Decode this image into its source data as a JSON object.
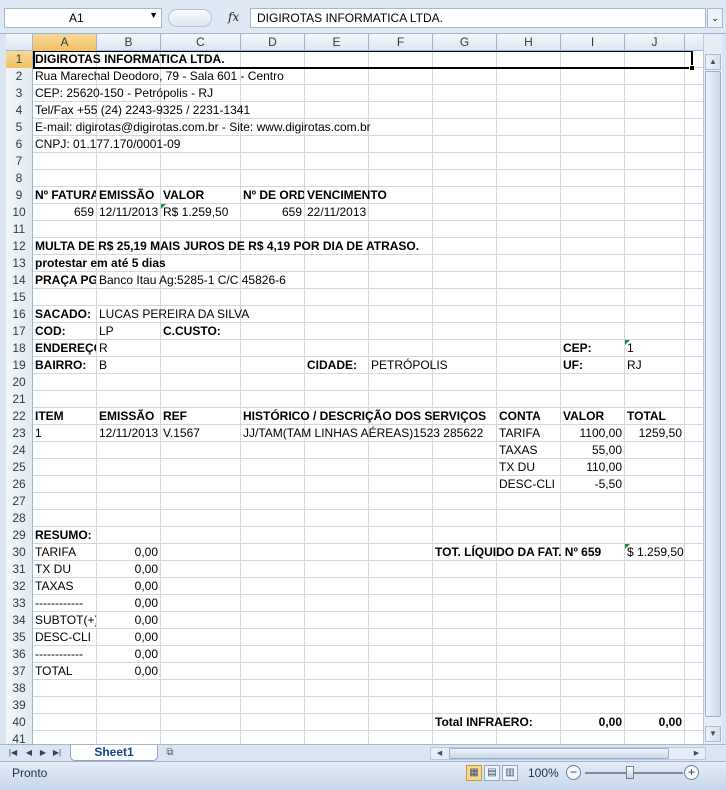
{
  "formula_bar": {
    "name_box": "A1",
    "fx_label": "fx",
    "content": "DIGIROTAS INFORMATICA LTDA."
  },
  "columns": [
    "A",
    "B",
    "C",
    "D",
    "E",
    "F",
    "G",
    "H",
    "I",
    "J"
  ],
  "rows": {
    "1": {
      "A": "DIGIROTAS INFORMATICA LTDA."
    },
    "2": {
      "A": "Rua Marechal Deodoro, 79 - Sala 601 - Centro"
    },
    "3": {
      "A": "CEP: 25620-150 - Petrópolis - RJ"
    },
    "4": {
      "A": "Tel/Fax +55 (24) 2243-9325 / 2231-1341"
    },
    "5": {
      "A": "E-mail: digirotas@digirotas.com.br - Site: www.digirotas.com.br"
    },
    "6": {
      "A": "CNPJ: 01.177.170/0001-09"
    },
    "9": {
      "A": "Nº FATURA",
      "B": "EMISSÃO",
      "C": "VALOR",
      "D": "Nº DE ORDEM",
      "E": "VENCIMENTO"
    },
    "10": {
      "A": "659",
      "B": "12/11/2013",
      "C": "R$ 1.259,50",
      "D": "659",
      "E": "22/11/2013"
    },
    "12": {
      "A": "MULTA DE R$ 25,19 MAIS JUROS DE R$ 4,19 POR DIA DE ATRASO."
    },
    "13": {
      "A": "protestar em até 5 dias"
    },
    "14": {
      "A": "PRAÇA PG",
      "B": "Banco Itau Ag:5285-1 C/C 45826-6"
    },
    "16": {
      "A": "SACADO:",
      "B": "LUCAS PEREIRA DA SILVA"
    },
    "17": {
      "A": "COD:",
      "B": "LP",
      "C": "C.CUSTO:"
    },
    "18": {
      "A": "ENDEREÇO",
      "B": "R",
      "I": "CEP:",
      "J": "1"
    },
    "19": {
      "A": "BAIRRO:",
      "B": "B",
      "E": "CIDADE:",
      "F": "PETRÓPOLIS",
      "I": "UF:",
      "J": "RJ"
    },
    "22": {
      "A": "ITEM",
      "B": "EMISSÃO",
      "C": "REF",
      "D": "HISTÓRICO / DESCRIÇÃO DOS SERVIÇOS",
      "H": "CONTA",
      "I": "VALOR",
      "J": "TOTAL"
    },
    "23": {
      "A": "1",
      "B": "12/11/2013",
      "C": "V.1567",
      "D": "JJ/TAM(TAM LINHAS AÉREAS)1523 285622",
      "H": "TARIFA",
      "I": "1100,00",
      "J": "1259,50"
    },
    "24": {
      "H": "TAXAS",
      "I": "55,00"
    },
    "25": {
      "H": "TX DU",
      "I": "110,00"
    },
    "26": {
      "H": "DESC-CLI",
      "I": "-5,50"
    },
    "29": {
      "A": "RESUMO:"
    },
    "30": {
      "A": "TARIFA",
      "B": "0,00",
      "G": "TOT. LÍQUIDO DA FAT. Nº 659",
      "J": "$ 1.259,50"
    },
    "31": {
      "A": "TX DU",
      "B": "0,00"
    },
    "32": {
      "A": "TAXAS",
      "B": "0,00"
    },
    "33": {
      "A": "------------",
      "B": "0,00"
    },
    "34": {
      "A": "SUBTOT(+)",
      "B": "0,00"
    },
    "35": {
      "A": "DESC-CLI",
      "B": "0,00"
    },
    "36": {
      "A": "------------",
      "B": "0,00"
    },
    "37": {
      "A": "TOTAL",
      "B": "0,00"
    },
    "40": {
      "G": "Total INFRAERO:",
      "I": "0,00",
      "J": "0,00"
    }
  },
  "sheet_tabs": [
    "Sheet1"
  ],
  "status": {
    "ready": "Pronto",
    "zoom": "100%"
  }
}
